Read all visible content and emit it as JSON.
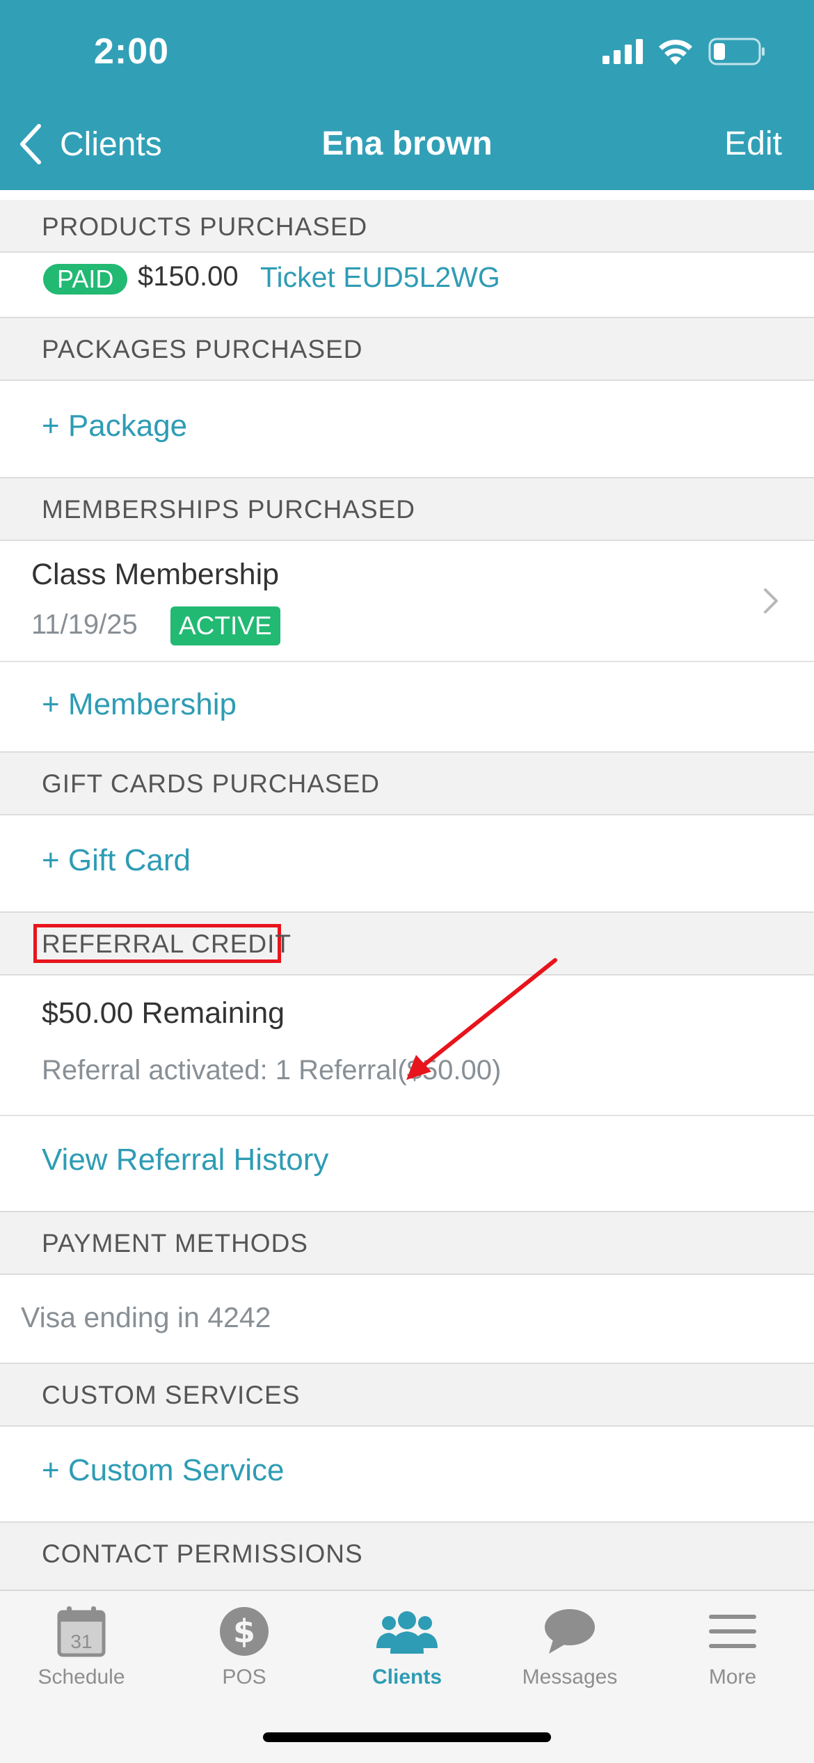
{
  "status_bar": {
    "time": "2:00"
  },
  "nav": {
    "back_label": "Clients",
    "title": "Ena brown",
    "edit_label": "Edit"
  },
  "products": {
    "header": "PRODUCTS PURCHASED",
    "badge": "PAID",
    "amount": "$150.00",
    "ticket": "Ticket EUD5L2WG"
  },
  "packages": {
    "header": "PACKAGES PURCHASED",
    "add_label": "+ Package"
  },
  "memberships": {
    "header": "MEMBERSHIPS PURCHASED",
    "item_title": "Class Membership",
    "item_date": "11/19/25",
    "item_status": "ACTIVE",
    "add_label": "+ Membership"
  },
  "gift_cards": {
    "header": "GIFT CARDS PURCHASED",
    "add_label": "+ Gift Card"
  },
  "referral": {
    "header": "REFERRAL CREDIT",
    "remaining": "$50.00 Remaining",
    "activated": "Referral activated: 1 Referral($50.00)",
    "history_label": "View Referral History"
  },
  "payment": {
    "header": "PAYMENT METHODS",
    "card": "Visa ending in 4242"
  },
  "custom_services": {
    "header": "CUSTOM SERVICES",
    "add_label": "+ Custom Service"
  },
  "contact": {
    "header": "CONTACT PERMISSIONS"
  },
  "tabs": [
    {
      "label": "Schedule",
      "icon": "calendar-icon",
      "calendar_day": "31"
    },
    {
      "label": "POS",
      "icon": "dollar-icon"
    },
    {
      "label": "Clients",
      "icon": "people-icon"
    },
    {
      "label": "Messages",
      "icon": "chat-icon"
    },
    {
      "label": "More",
      "icon": "menu-icon"
    }
  ],
  "colors": {
    "brand": "#31a0b7",
    "link": "#2e9cb4",
    "badge_green": "#22b973",
    "highlight_red": "#e8141c"
  }
}
